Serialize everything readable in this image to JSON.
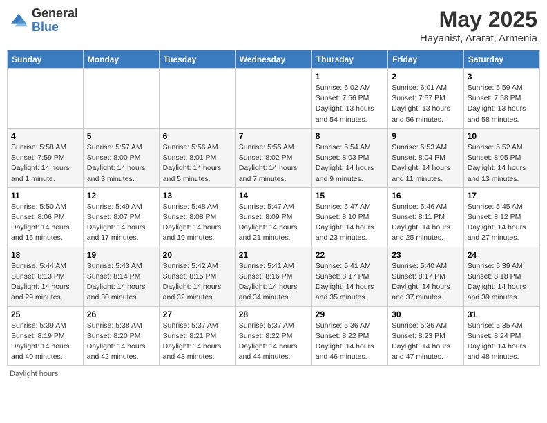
{
  "header": {
    "logo_general": "General",
    "logo_blue": "Blue",
    "title": "May 2025",
    "location": "Hayanist, Ararat, Armenia"
  },
  "days_of_week": [
    "Sunday",
    "Monday",
    "Tuesday",
    "Wednesday",
    "Thursday",
    "Friday",
    "Saturday"
  ],
  "weeks": [
    [
      {
        "day": "",
        "info": ""
      },
      {
        "day": "",
        "info": ""
      },
      {
        "day": "",
        "info": ""
      },
      {
        "day": "",
        "info": ""
      },
      {
        "day": "1",
        "info": "Sunrise: 6:02 AM\nSunset: 7:56 PM\nDaylight: 13 hours\nand 54 minutes."
      },
      {
        "day": "2",
        "info": "Sunrise: 6:01 AM\nSunset: 7:57 PM\nDaylight: 13 hours\nand 56 minutes."
      },
      {
        "day": "3",
        "info": "Sunrise: 5:59 AM\nSunset: 7:58 PM\nDaylight: 13 hours\nand 58 minutes."
      }
    ],
    [
      {
        "day": "4",
        "info": "Sunrise: 5:58 AM\nSunset: 7:59 PM\nDaylight: 14 hours\nand 1 minute."
      },
      {
        "day": "5",
        "info": "Sunrise: 5:57 AM\nSunset: 8:00 PM\nDaylight: 14 hours\nand 3 minutes."
      },
      {
        "day": "6",
        "info": "Sunrise: 5:56 AM\nSunset: 8:01 PM\nDaylight: 14 hours\nand 5 minutes."
      },
      {
        "day": "7",
        "info": "Sunrise: 5:55 AM\nSunset: 8:02 PM\nDaylight: 14 hours\nand 7 minutes."
      },
      {
        "day": "8",
        "info": "Sunrise: 5:54 AM\nSunset: 8:03 PM\nDaylight: 14 hours\nand 9 minutes."
      },
      {
        "day": "9",
        "info": "Sunrise: 5:53 AM\nSunset: 8:04 PM\nDaylight: 14 hours\nand 11 minutes."
      },
      {
        "day": "10",
        "info": "Sunrise: 5:52 AM\nSunset: 8:05 PM\nDaylight: 14 hours\nand 13 minutes."
      }
    ],
    [
      {
        "day": "11",
        "info": "Sunrise: 5:50 AM\nSunset: 8:06 PM\nDaylight: 14 hours\nand 15 minutes."
      },
      {
        "day": "12",
        "info": "Sunrise: 5:49 AM\nSunset: 8:07 PM\nDaylight: 14 hours\nand 17 minutes."
      },
      {
        "day": "13",
        "info": "Sunrise: 5:48 AM\nSunset: 8:08 PM\nDaylight: 14 hours\nand 19 minutes."
      },
      {
        "day": "14",
        "info": "Sunrise: 5:47 AM\nSunset: 8:09 PM\nDaylight: 14 hours\nand 21 minutes."
      },
      {
        "day": "15",
        "info": "Sunrise: 5:47 AM\nSunset: 8:10 PM\nDaylight: 14 hours\nand 23 minutes."
      },
      {
        "day": "16",
        "info": "Sunrise: 5:46 AM\nSunset: 8:11 PM\nDaylight: 14 hours\nand 25 minutes."
      },
      {
        "day": "17",
        "info": "Sunrise: 5:45 AM\nSunset: 8:12 PM\nDaylight: 14 hours\nand 27 minutes."
      }
    ],
    [
      {
        "day": "18",
        "info": "Sunrise: 5:44 AM\nSunset: 8:13 PM\nDaylight: 14 hours\nand 29 minutes."
      },
      {
        "day": "19",
        "info": "Sunrise: 5:43 AM\nSunset: 8:14 PM\nDaylight: 14 hours\nand 30 minutes."
      },
      {
        "day": "20",
        "info": "Sunrise: 5:42 AM\nSunset: 8:15 PM\nDaylight: 14 hours\nand 32 minutes."
      },
      {
        "day": "21",
        "info": "Sunrise: 5:41 AM\nSunset: 8:16 PM\nDaylight: 14 hours\nand 34 minutes."
      },
      {
        "day": "22",
        "info": "Sunrise: 5:41 AM\nSunset: 8:17 PM\nDaylight: 14 hours\nand 35 minutes."
      },
      {
        "day": "23",
        "info": "Sunrise: 5:40 AM\nSunset: 8:17 PM\nDaylight: 14 hours\nand 37 minutes."
      },
      {
        "day": "24",
        "info": "Sunrise: 5:39 AM\nSunset: 8:18 PM\nDaylight: 14 hours\nand 39 minutes."
      }
    ],
    [
      {
        "day": "25",
        "info": "Sunrise: 5:39 AM\nSunset: 8:19 PM\nDaylight: 14 hours\nand 40 minutes."
      },
      {
        "day": "26",
        "info": "Sunrise: 5:38 AM\nSunset: 8:20 PM\nDaylight: 14 hours\nand 42 minutes."
      },
      {
        "day": "27",
        "info": "Sunrise: 5:37 AM\nSunset: 8:21 PM\nDaylight: 14 hours\nand 43 minutes."
      },
      {
        "day": "28",
        "info": "Sunrise: 5:37 AM\nSunset: 8:22 PM\nDaylight: 14 hours\nand 44 minutes."
      },
      {
        "day": "29",
        "info": "Sunrise: 5:36 AM\nSunset: 8:22 PM\nDaylight: 14 hours\nand 46 minutes."
      },
      {
        "day": "30",
        "info": "Sunrise: 5:36 AM\nSunset: 8:23 PM\nDaylight: 14 hours\nand 47 minutes."
      },
      {
        "day": "31",
        "info": "Sunrise: 5:35 AM\nSunset: 8:24 PM\nDaylight: 14 hours\nand 48 minutes."
      }
    ]
  ],
  "footer": {
    "daylight_label": "Daylight hours"
  },
  "colors": {
    "header_bg": "#3a7abf",
    "header_text": "#ffffff",
    "accent": "#3a7abf"
  }
}
